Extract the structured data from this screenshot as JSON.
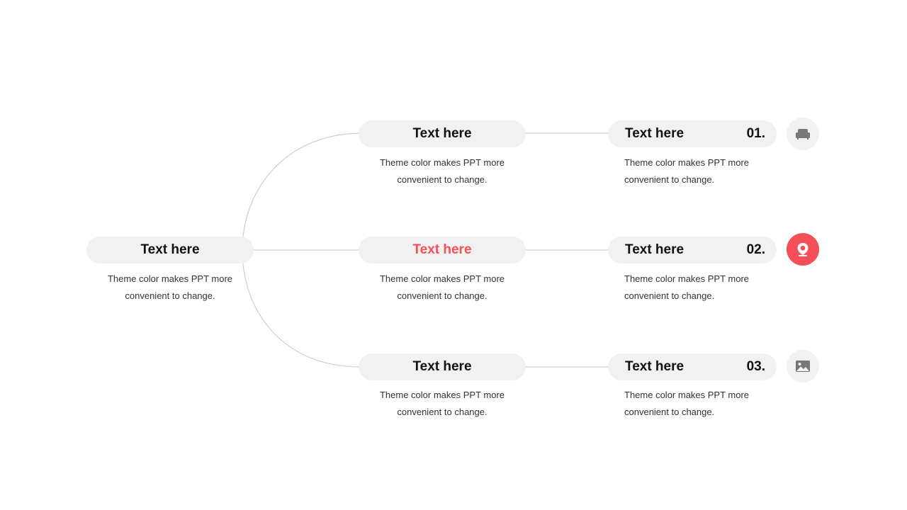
{
  "root": {
    "title": "Text here",
    "desc_line1": "Theme color makes PPT more",
    "desc_line2": "convenient to change."
  },
  "middle": [
    {
      "title": "Text here",
      "desc_line1": "Theme color makes PPT more",
      "desc_line2": "convenient to change.",
      "highlighted": false
    },
    {
      "title": "Text here",
      "desc_line1": "Theme color makes PPT more",
      "desc_line2": "convenient to change.",
      "highlighted": true
    },
    {
      "title": "Text here",
      "desc_line1": "Theme color makes PPT more",
      "desc_line2": "convenient to change.",
      "highlighted": false
    }
  ],
  "right": [
    {
      "title": "Text here",
      "number": "01.",
      "desc_line1": "Theme color makes PPT more",
      "desc_line2": "convenient to change.",
      "icon": "sofa-icon"
    },
    {
      "title": "Text here",
      "number": "02.",
      "desc_line1": "Theme color makes PPT more",
      "desc_line2": "convenient to change.",
      "icon": "location-pin-icon"
    },
    {
      "title": "Text here",
      "number": "03.",
      "desc_line1": "Theme color makes PPT more",
      "desc_line2": "convenient to change.",
      "icon": "image-icon"
    }
  ],
  "colors": {
    "accent": "#f5505a",
    "pill_bg": "#f1f1f1",
    "line": "#cccccc",
    "icon_gray": "#777777"
  }
}
